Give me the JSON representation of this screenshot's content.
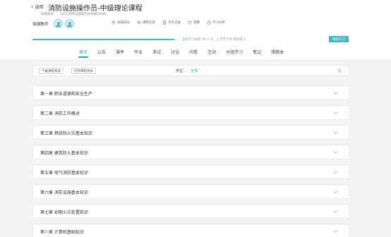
{
  "header": {
    "back_label": "返回",
    "title": "消防设施操作员-中级理论课程",
    "sub_category": "技能培训",
    "sub_class": "2025消防设施操作员中级209班",
    "teacher_label": "授课教师"
  },
  "toolbar": {
    "items": [
      {
        "label": "班级成员",
        "icon": "people-icon"
      },
      {
        "label": "课程信息",
        "icon": "layers-icon"
      },
      {
        "label": "点名记录",
        "icon": "document-icon"
      },
      {
        "label": "提醒",
        "icon": "heart-icon"
      },
      {
        "label": "学习分析",
        "icon": "chart-icon"
      }
    ]
  },
  "progress": {
    "text": "当前学习进度 98.7 %，上次学习到 模拟练习",
    "percent": 98.7,
    "continue_label": "继续学习"
  },
  "tabs": [
    "章节",
    "公告",
    "课件",
    "作业",
    "测试",
    "讨论",
    "问卷",
    "互动",
    "分组学习",
    "笔记",
    "错题本"
  ],
  "active_tab": 0,
  "filter": {
    "download_label": "下载课程目录",
    "print_label": "打印课程目录",
    "type_label": "类型：",
    "type_value": "全部"
  },
  "chapters": [
    "第一章 职业道德和安全生产",
    "第二章 消防工作概述",
    "第三章 燃烧和火灾基本知识",
    "第四章 建筑防火基本知识",
    "第五章 电气消防基本知识",
    "第六章 消防设施基本知识",
    "第七章 初期火灾处置知识",
    "第八章 计算机基础知识"
  ],
  "colors": {
    "accent": "#2aa3b8",
    "button": "#4ab4c4",
    "background": "#f3f4f6"
  }
}
